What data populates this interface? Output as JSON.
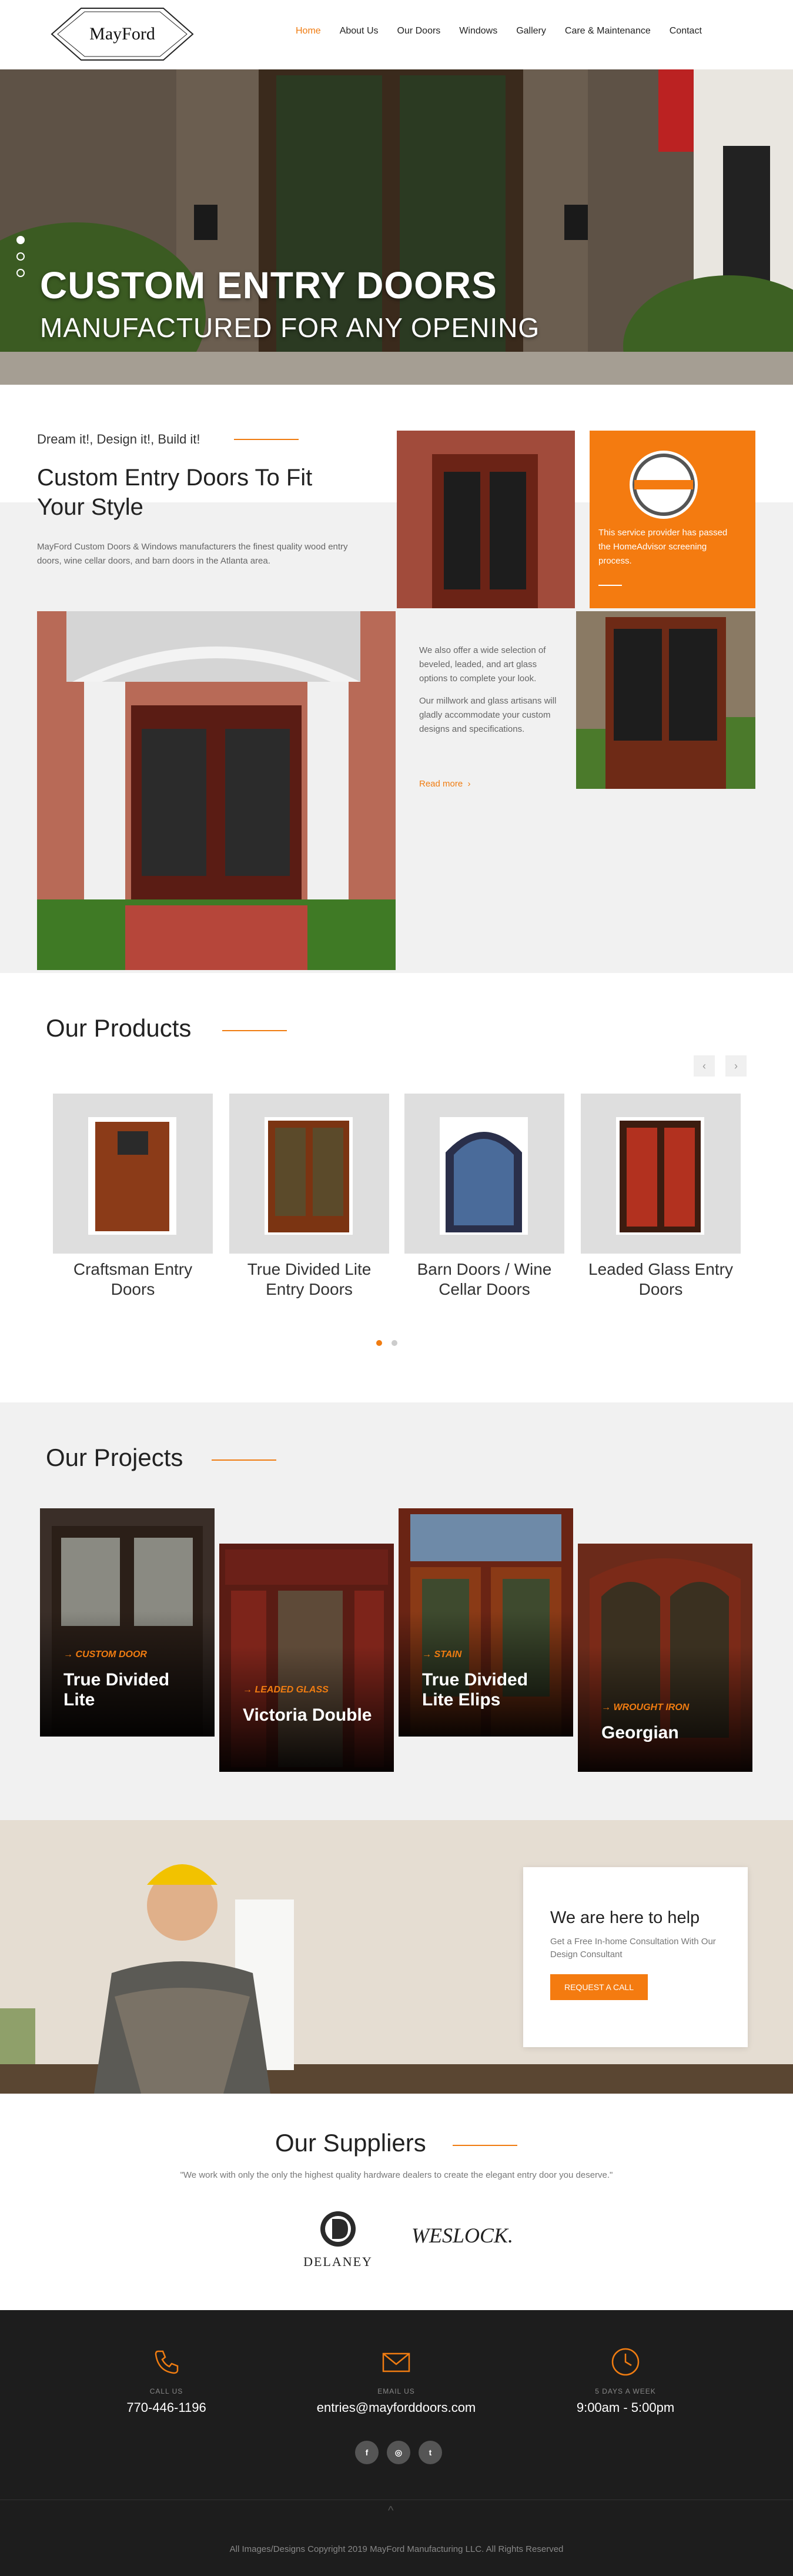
{
  "header": {
    "logo": "MayFord",
    "nav": [
      "Home",
      "About Us",
      "Our Doors",
      "Windows",
      "Gallery",
      "Care & Maintenance",
      "Contact"
    ],
    "active": "Home"
  },
  "hero": {
    "title": "CUSTOM ENTRY DOORS",
    "subtitle": "MANUFACTURED FOR ANY OPENING",
    "slides": 3,
    "active_slide": 1
  },
  "intro": {
    "tagline": "Dream it!, Design it!, Build it!",
    "title": "Custom Entry Doors To Fit Your Style",
    "text": "MayFord Custom Doors & Windows manufacturers the finest quality wood entry doors, wine cellar doors, and barn doors in the Atlanta area.",
    "badge_text": "This service provider has passed the HomeAdvisor screening process.",
    "badge_brand": "HomeAdvisor",
    "mid_text_1": "We also offer a wide selection of beveled, leaded, and art glass options to complete your look.",
    "mid_text_2": "Our millwork and glass artisans will gladly accommodate your custom designs and specifications.",
    "read_more": "Read more"
  },
  "products": {
    "title": "Our Products",
    "prev": "‹",
    "next": "›",
    "items": [
      {
        "name": "Craftsman Entry Doors"
      },
      {
        "name": "True Divided Lite Entry Doors"
      },
      {
        "name": "Barn Doors / Wine Cellar Doors"
      },
      {
        "name": "Leaded Glass Entry Doors"
      }
    ]
  },
  "projects": {
    "title": "Our Projects",
    "items": [
      {
        "category": "CUSTOM DOOR",
        "name": "True Divided Lite"
      },
      {
        "category": "LEADED GLASS",
        "name": "Victoria Double"
      },
      {
        "category": "STAIN",
        "name": "True Divided Lite Elips"
      },
      {
        "category": "WROUGHT IRON",
        "name": "Georgian"
      }
    ]
  },
  "help": {
    "title": "We are here to help",
    "text": "Get a Free In-home Consultation With Our Design Consultant",
    "button": "REQUEST A CALL"
  },
  "suppliers": {
    "title": "Our Suppliers",
    "quote": "\"We work with only the only the highest quality hardware dealers to create the elegant entry door you deserve.\"",
    "logos": [
      "DELANEY",
      "WESLOCK."
    ]
  },
  "footer": {
    "contacts": [
      {
        "label": "CALL US",
        "value": "770-446-1196",
        "icon": "phone-icon"
      },
      {
        "label": "EMAIL US",
        "value": "entries@mayforddoors.com",
        "icon": "mail-icon"
      },
      {
        "label": "5 DAYS A WEEK",
        "value": "9:00am - 5:00pm",
        "icon": "clock-icon"
      }
    ],
    "socials": [
      "f",
      "◎",
      "t"
    ],
    "copyright": "All Images/Designs Copyright 2019 MayFord Manufacturing LLC. All Rights Reserved"
  },
  "colors": {
    "accent": "#f07c11",
    "footer": "#1d1d1d",
    "band": "#f1f1f1"
  }
}
